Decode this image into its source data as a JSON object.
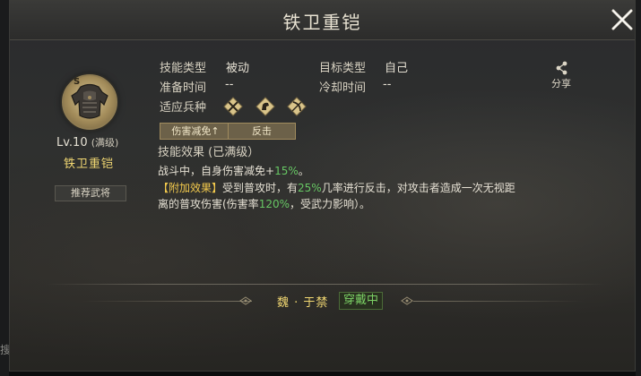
{
  "window": {
    "title": "铁卫重铠",
    "edge_glyph": "搜"
  },
  "skill": {
    "level": "Lv.10",
    "level_max": "(满级)",
    "name": "铁卫重铠",
    "recommend_label": "推荐武将"
  },
  "info": {
    "skill_type_label": "技能类型",
    "skill_type_value": "被动",
    "target_type_label": "目标类型",
    "target_type_value": "自己",
    "prepare_time_label": "准备时间",
    "prepare_time_value": "--",
    "cooldown_label": "冷却时间",
    "cooldown_value": "--",
    "unit_label": "适应兵种",
    "units": [
      "cavalry-icon",
      "horse-icon",
      "archer-icon"
    ]
  },
  "tags": [
    "伤害减免↑",
    "反击"
  ],
  "effect": {
    "title": "技能效果 (已满级）",
    "line1_a": "战斗中，自身伤害减免+",
    "line1_value": "15%",
    "line1_b": "。",
    "line2_tag": "【附加效果】",
    "line2_a": "受到普攻时，有",
    "line2_value": "25%",
    "line2_b": "几率进行反击，对攻击者造成一次无视距",
    "line3_a": "离的普攻伤害(伤害率",
    "line3_value": "120%",
    "line3_b": "，受武力影响）。"
  },
  "share": {
    "label": "分享"
  },
  "footer": {
    "wearer": "魏 · 于禁",
    "status": "穿戴中"
  },
  "colors": {
    "gold": "#f1d772",
    "green": "#67c764",
    "tag_bg": "#6c6149"
  }
}
